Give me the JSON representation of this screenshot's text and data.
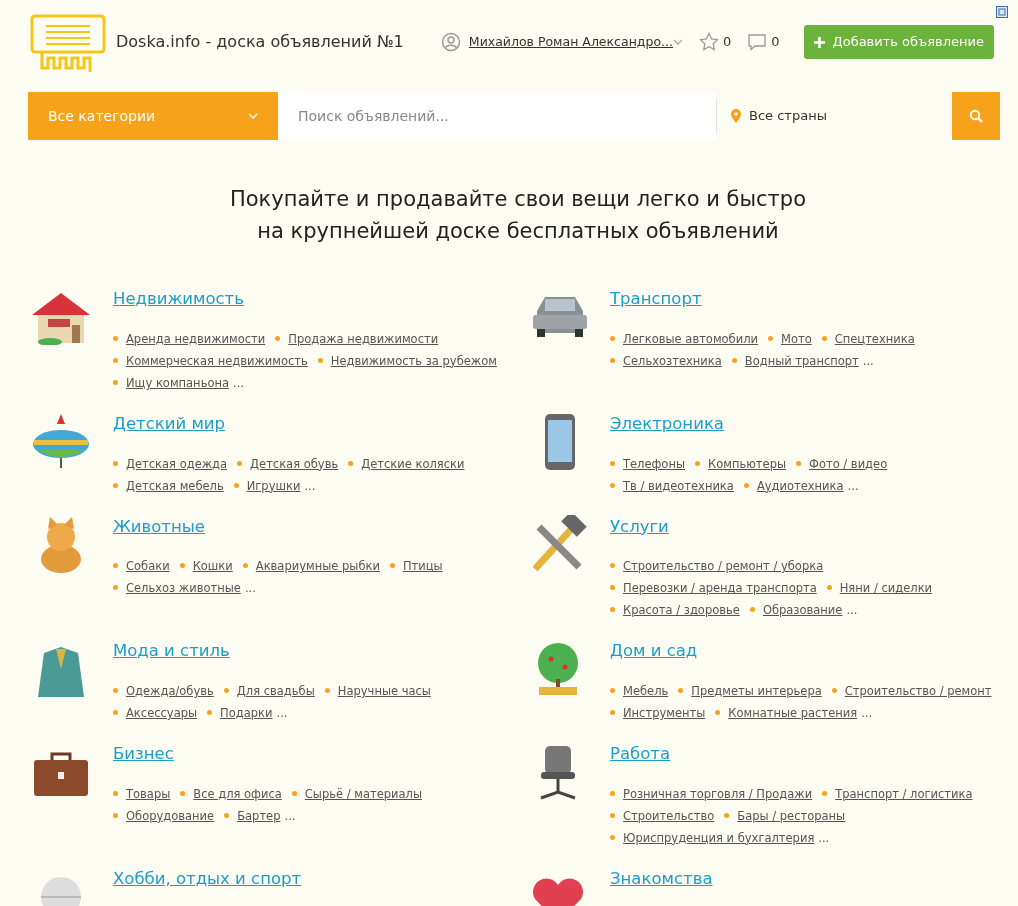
{
  "header": {
    "site_title": "Doska.info - доска объявлений №1",
    "user_name": "Михайлов Роман Александро...",
    "favorites_count": "0",
    "messages_count": "0",
    "add_button": "Добавить объявление"
  },
  "search": {
    "category": "Все категории",
    "placeholder": "Поиск объявлений...",
    "location": "Все страны"
  },
  "headline": [
    "Покупайте и продавайте свои вещи легко и быстро",
    "на крупнейшей доске бесплатных объявлений"
  ],
  "categories": [
    {
      "title": "Недвижимость",
      "links": [
        "Аренда недвижимости",
        "Продажа недвижимости",
        "Коммерческая недвижимость",
        "Недвижимость за рубежом",
        "Ищу компаньона"
      ],
      "more": "..."
    },
    {
      "title": "Транспорт",
      "links": [
        "Легковые автомобили",
        "Мото",
        "Спецтехника",
        "Сельхозтехника",
        "Водный транспорт"
      ],
      "more": "..."
    },
    {
      "title": "Детский мир",
      "links": [
        "Детская одежда",
        "Детская обувь",
        "Детские коляски",
        "Детская мебель",
        "Игрушки"
      ],
      "more": "..."
    },
    {
      "title": "Электроника",
      "links": [
        "Телефоны",
        "Компьютеры",
        "Фото / видео",
        "Тв / видеотехника",
        "Аудиотехника"
      ],
      "more": "..."
    },
    {
      "title": "Животные",
      "links": [
        "Собаки",
        "Кошки",
        "Аквариумные рыбки",
        "Птицы",
        "Сельхоз животные"
      ],
      "more": "..."
    },
    {
      "title": "Услуги",
      "links": [
        "Строительство / ремонт / уборка",
        "Перевозки / аренда транспорта",
        "Няни / сиделки",
        "Красота / здоровье",
        "Образование"
      ],
      "more": "..."
    },
    {
      "title": "Мода и стиль",
      "links": [
        "Одежда/обувь",
        "Для свадьбы",
        "Наручные часы",
        "Аксессуары",
        "Подарки"
      ],
      "more": "..."
    },
    {
      "title": "Дом и сад",
      "links": [
        "Мебель",
        "Предметы интерьера",
        "Строительство / ремонт",
        "Инструменты",
        "Комнатные растения"
      ],
      "more": "..."
    },
    {
      "title": "Бизнес",
      "links": [
        "Товары",
        "Все для офиса",
        "Сырьё / материалы",
        "Оборудование",
        "Бартер"
      ],
      "more": "..."
    },
    {
      "title": "Работа",
      "links": [
        "Розничная торговля / Продажи",
        "Транспорт / логистика",
        "Строительство",
        "Бары / рестораны",
        "Юриспруденция и бухгалтерия"
      ],
      "more": "..."
    },
    {
      "title": "Хобби, отдых и спорт"
    },
    {
      "title": "Знакомства"
    }
  ]
}
